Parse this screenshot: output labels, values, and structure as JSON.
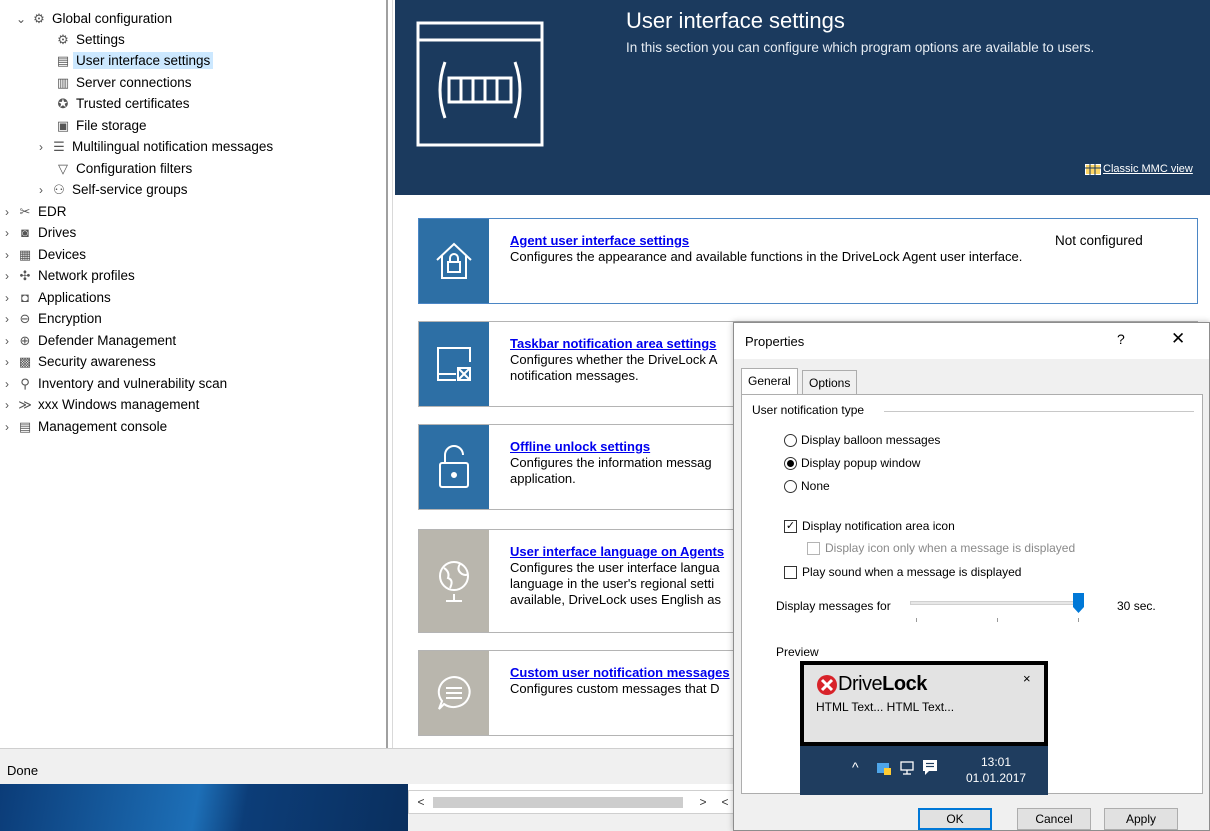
{
  "tree": {
    "items": [
      {
        "label": "Global configuration",
        "icon": "gear-group-icon",
        "expanded": true
      },
      {
        "label": "Settings",
        "icon": "gear-icon"
      },
      {
        "label": "User interface settings",
        "icon": "ui-window-icon",
        "selected": true
      },
      {
        "label": "Server connections",
        "icon": "server-icon"
      },
      {
        "label": "Trusted certificates",
        "icon": "certificate-icon"
      },
      {
        "label": "File storage",
        "icon": "file-storage-icon"
      },
      {
        "label": "Multilingual notification messages",
        "icon": "message-list-icon"
      },
      {
        "label": "Configuration filters",
        "icon": "filter-icon"
      },
      {
        "label": "Self-service groups",
        "icon": "group-icon"
      },
      {
        "label": "EDR",
        "icon": "tools-icon"
      },
      {
        "label": "Drives",
        "icon": "drive-icon"
      },
      {
        "label": "Devices",
        "icon": "devices-icon"
      },
      {
        "label": "Network profiles",
        "icon": "network-icon"
      },
      {
        "label": "Applications",
        "icon": "applications-icon"
      },
      {
        "label": "Encryption",
        "icon": "lock-icon"
      },
      {
        "label": "Defender Management",
        "icon": "shield-icon"
      },
      {
        "label": "Security awareness",
        "icon": "awareness-icon"
      },
      {
        "label": "Inventory and vulnerability scan",
        "icon": "scan-icon"
      },
      {
        "label": "xxx Windows management",
        "icon": "windows-management-icon"
      },
      {
        "label": "Management console",
        "icon": "console-icon"
      }
    ]
  },
  "header": {
    "title": "User interface settings",
    "subtitle": "In this section you can configure which program options are available to users.",
    "mmc_link": "Classic MMC view"
  },
  "cards": [
    {
      "title": "Agent user interface settings",
      "desc": "Configures the appearance and available functions in the DriveLock Agent user interface.",
      "status": "Not configured",
      "color": "#2d6fa5"
    },
    {
      "title": "Taskbar notification area settings",
      "desc": "Configures whether the DriveLock A notification messages.",
      "status": "",
      "color": "#2d6fa5"
    },
    {
      "title": "Offline unlock settings",
      "desc": "Configures the information messag application.",
      "status": "",
      "color": "#2d6fa5"
    },
    {
      "title": "User interface language on Agents",
      "desc": "Configures the user interface langua language in the user's regional setti available, DriveLock uses English as",
      "status": "",
      "color": "#b9b6ad"
    },
    {
      "title": "Custom user notification messages",
      "desc": "Configures custom messages that D",
      "status": "",
      "color": "#b9b6ad"
    }
  ],
  "status": {
    "text": "Done"
  },
  "dialog": {
    "title": "Properties",
    "help": "?",
    "close": "✕",
    "tabs": [
      "General",
      "Options"
    ],
    "group_label": "User notification type",
    "radios": [
      {
        "label": "Display balloon messages",
        "checked": false
      },
      {
        "label": "Display popup window",
        "checked": true
      },
      {
        "label": "None",
        "checked": false
      }
    ],
    "checkboxes": [
      {
        "label": "Display notification area icon",
        "checked": true,
        "disabled": false
      },
      {
        "label": "Display icon only when a message is displayed",
        "checked": false,
        "disabled": true
      },
      {
        "label": "Play sound when a message is displayed",
        "checked": false,
        "disabled": false
      }
    ],
    "slider": {
      "label": "Display messages for",
      "value": "30",
      "unit": "sec.",
      "level": 1.0
    },
    "preview": {
      "label": "Preview",
      "brand_pre": "Drive",
      "brand_post": "Lock",
      "close": "×",
      "text": "HTML Text...  HTML Text...",
      "time": "13:01",
      "date": "01.01.2017"
    },
    "buttons": {
      "ok": "OK",
      "cancel": "Cancel",
      "apply": "Apply"
    }
  },
  "scroll": {
    "left": "<",
    "right": ">"
  }
}
